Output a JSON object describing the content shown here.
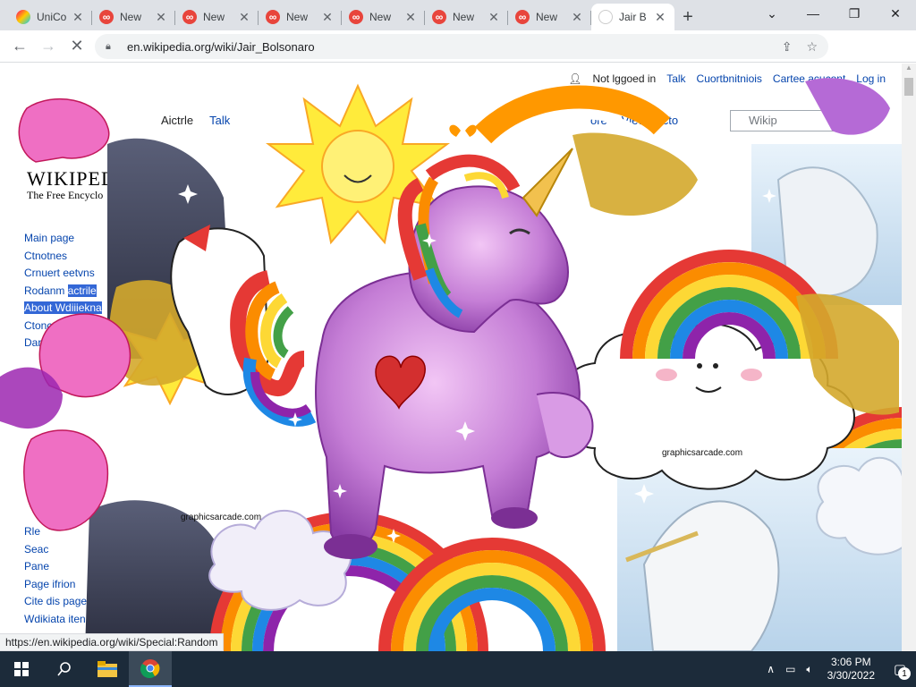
{
  "browser": {
    "tabs": [
      {
        "title": "UniCo",
        "favicon": "unicorn-favicon",
        "active": false
      },
      {
        "title": "New",
        "favicon": "infinity-favicon",
        "active": false
      },
      {
        "title": "New",
        "favicon": "infinity-favicon",
        "active": false
      },
      {
        "title": "New",
        "favicon": "infinity-favicon",
        "active": false
      },
      {
        "title": "New",
        "favicon": "infinity-favicon",
        "active": false
      },
      {
        "title": "New",
        "favicon": "infinity-favicon",
        "active": false
      },
      {
        "title": "New",
        "favicon": "infinity-favicon",
        "active": false
      },
      {
        "title": "Jair B",
        "favicon": "wikipedia-favicon",
        "active": true
      }
    ],
    "new_tab": "+",
    "url": "en.wikipedia.org/wiki/Jair_Bolsonaro",
    "status_url": "https://en.wikipedia.org/wiki/Special:Random"
  },
  "wikipedia": {
    "personal": [
      "Not lggoed in",
      "Talk",
      "Cuortbnitniois",
      "Cartee acucont",
      "Log in"
    ],
    "logo_text": "WIKIPEDI",
    "tagline": "The Free Encyclo",
    "tabs": [
      "Aictrle",
      "Talk"
    ],
    "right_tabs": [
      "ore",
      "View hricto"
    ],
    "search_placeholder": "Wikip",
    "nav": [
      {
        "label": "Main page",
        "hl": ""
      },
      {
        "label": "Ctnotnes",
        "hl": ""
      },
      {
        "label": "Crnuert eetvns",
        "hl": ""
      },
      {
        "label": "Rodanm ",
        "hl": "actrile"
      },
      {
        "label": "About Wd",
        "hl": "iiiekna"
      },
      {
        "label": "Ctoncat us",
        "hl": ""
      },
      {
        "label": "Dar",
        "hl": ""
      }
    ],
    "nav2": [
      "Rle",
      "Seac",
      "Pane",
      "Page ifrion",
      "Cite dis page",
      "Wdikiata iten"
    ],
    "overlay_text": "graphicsarcade.com"
  },
  "taskbar": {
    "time": "3:06 PM",
    "date": "3/30/2022",
    "notifications": "1"
  }
}
